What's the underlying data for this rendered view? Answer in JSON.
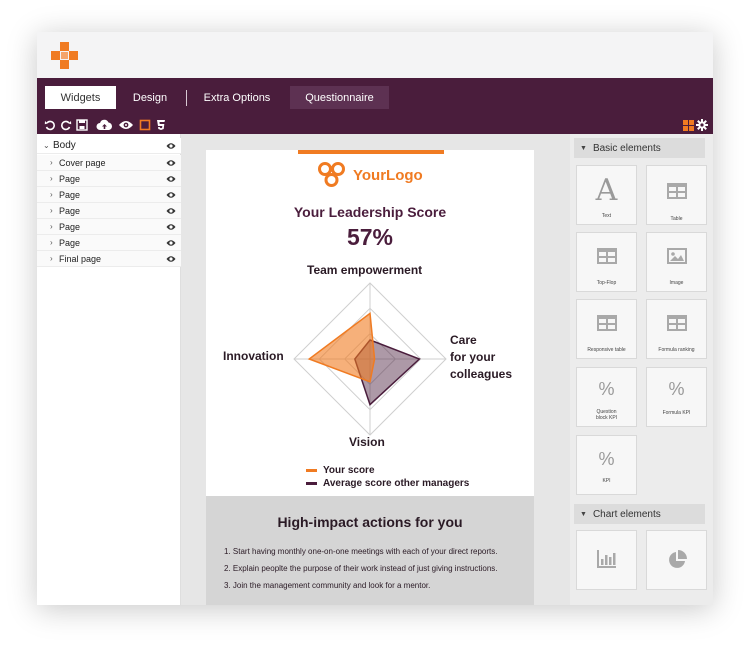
{
  "tabs": [
    {
      "label": "Widgets",
      "active": true
    },
    {
      "label": "Design",
      "active": false
    },
    {
      "label": "Extra Options",
      "active": false
    },
    {
      "label": "Questionnaire",
      "active": false
    }
  ],
  "toolbar_icons": [
    "undo-icon",
    "redo-icon",
    "save-icon",
    "cloud-upload-icon",
    "preview-eye-icon",
    "frame-icon",
    "html5-icon"
  ],
  "toolbar_right_icons": [
    "grid-layout-icon",
    "settings-gear-icon"
  ],
  "tree": {
    "root": "Body",
    "items": [
      "Cover page",
      "Page",
      "Page",
      "Page",
      "Page",
      "Page",
      "Final page"
    ]
  },
  "document": {
    "logo_text": "YourLogo",
    "score_title": "Your Leadership Score",
    "score_value": "57%",
    "radar": {
      "axes": [
        "Team empowerment",
        "Care for your colleagues",
        "Vision",
        "Innovation"
      ],
      "axis_label_lines": {
        "right": [
          "Care",
          "for your",
          "colleagues"
        ]
      },
      "series": [
        {
          "name": "Your score",
          "color": "#f07b22",
          "values": [
            0.6,
            0.06,
            0.3,
            0.8
          ]
        },
        {
          "name": "Average score other managers",
          "color": "#4a1d3c",
          "values": [
            0.25,
            0.65,
            0.6,
            0.2
          ]
        }
      ]
    },
    "actions_title": "High-impact actions for you",
    "actions": [
      "1. Start having monthly one-on-one meetings with each of your direct reports.",
      "2. Explain peoplte the purpose of their work instead of just giving instructions.",
      "3. Join the management community and look for a mentor."
    ]
  },
  "right_panel": {
    "basic_header": "Basic elements",
    "basic_widgets": [
      "Text",
      "Table",
      "Top-Flop",
      "Image",
      "Responsive table",
      "Formula ranking",
      "Question block KPI",
      "Formula KPI",
      "KPI"
    ],
    "chart_header": "Chart elements",
    "chart_widgets": [
      "bar-chart-icon",
      "pie-chart-icon"
    ]
  },
  "colors": {
    "brand_orange": "#f07b22",
    "brand_purple": "#4a1d3c"
  }
}
